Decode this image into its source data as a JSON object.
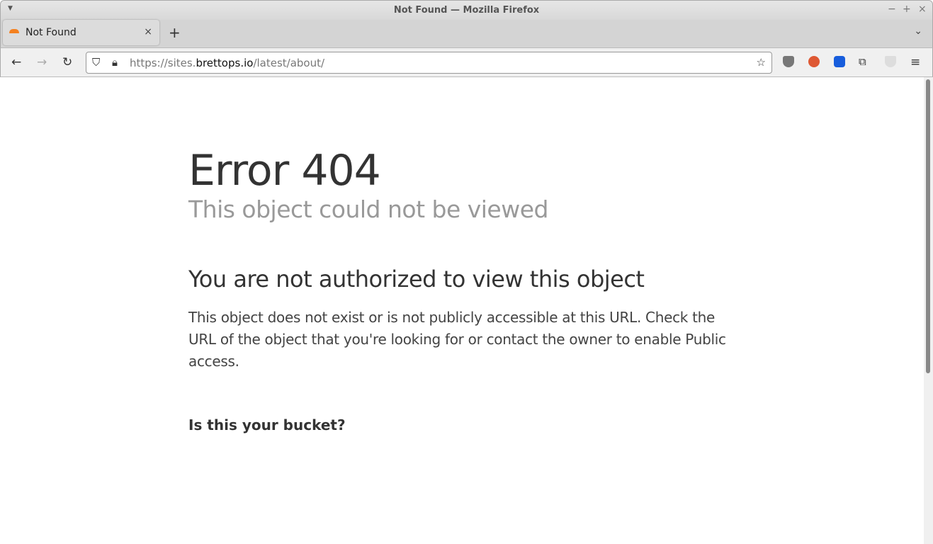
{
  "window": {
    "title": "Not Found — Mozilla Firefox"
  },
  "tab": {
    "label": "Not Found",
    "close": "×"
  },
  "new_tab": "+",
  "url": {
    "scheme": "https://sites.",
    "domain": "brettops.io",
    "path": "/latest/about/"
  },
  "extensions": [
    "ublock-origin-icon",
    "duckduckgo-icon",
    "bitwarden-icon",
    "extensions-icon",
    "privacy-badger-icon"
  ],
  "page": {
    "heading": "Error 404",
    "subheading": "This object could not be viewed",
    "section_title": "You are not authorized to view this object",
    "body": "This object does not exist or is not publicly accessible at this URL. Check the URL of the object that you're looking for or contact the owner to enable Public access.",
    "bucket_heading": "Is this your bucket?"
  }
}
